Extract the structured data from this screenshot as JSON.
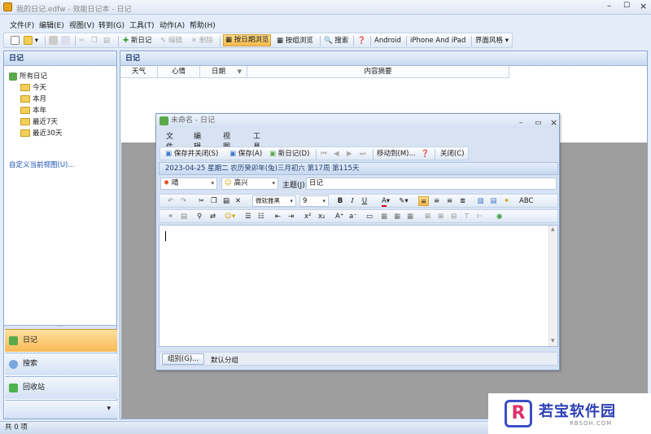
{
  "app": {
    "title": "我的日记.edfw - 效能日记本 - 日记",
    "status": "共 0 项"
  },
  "menu": [
    "文件(F)",
    "编辑(E)",
    "视图(V)",
    "转到(G)",
    "工具(T)",
    "动作(A)",
    "帮助(H)"
  ],
  "toolbar": {
    "new": "新日记",
    "edit": "编辑",
    "delete": "删除",
    "by_date": "按日期浏览",
    "by_group": "按组浏览",
    "search": "搜索",
    "android": "Android",
    "iphone": "iPhone And iPad",
    "skin": "界面风格"
  },
  "left": {
    "header": "日记",
    "tree": {
      "root": "所有日记",
      "items": [
        "今天",
        "本月",
        "本年",
        "最近7天",
        "最近30天"
      ]
    },
    "custom_view": "自定义当前视图(U)...",
    "nav": [
      "日记",
      "搜索",
      "回收站"
    ]
  },
  "right": {
    "header": "日记",
    "columns": [
      "天气",
      "心情",
      "日期",
      "内容摘要"
    ]
  },
  "dialog": {
    "title": "未命名 - 日记",
    "menu": [
      "文件(F)",
      "编辑(E)",
      "视图(V)",
      "工具(T)"
    ],
    "toolbar": {
      "save_close": "保存并关闭(S)",
      "save": "保存(A)",
      "new": "新日记(D)",
      "move": "移动到(M)...",
      "close": "关闭(C)"
    },
    "info": "2023-04-25 星期二 农历癸卯年(兔)三月初六  第17周 第115天",
    "weather": "晴",
    "mood": "高兴",
    "subject_label": "主题(J):",
    "subject": "日记",
    "font": "微软雅黑",
    "size": "9",
    "group_button": "组别(G)...",
    "group": "默认分组"
  },
  "watermark": {
    "brand": "若宝软件园",
    "url": "RBSOH.COM"
  }
}
